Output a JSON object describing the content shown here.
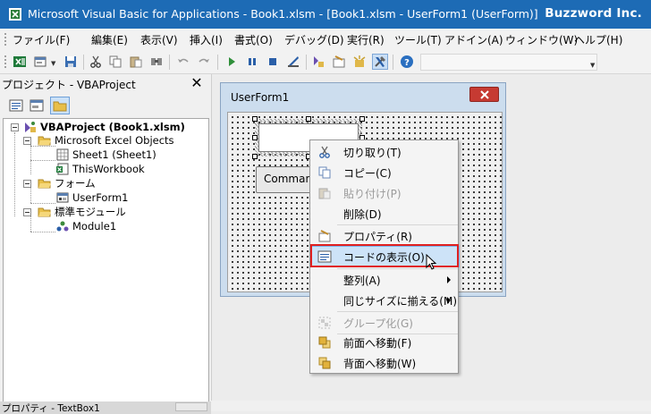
{
  "window": {
    "title": "Microsoft Visual Basic for Applications - Book1.xlsm - [Book1.xlsm - UserForm1 (UserForm)]",
    "brand": "Buzzword Inc."
  },
  "menu": [
    {
      "label": "ファイル(F)"
    },
    {
      "label": "編集(E)"
    },
    {
      "label": "表示(V)"
    },
    {
      "label": "挿入(I)"
    },
    {
      "label": "書式(O)"
    },
    {
      "label": "デバッグ(D)"
    },
    {
      "label": "実行(R)"
    },
    {
      "label": "ツール(T)"
    },
    {
      "label": "アドイン(A)"
    },
    {
      "label": "ウィンドウ(W)"
    },
    {
      "label": "ヘルプ(H)"
    }
  ],
  "toolbar": {
    "icons": [
      "excel-icon",
      "insert-userform-icon",
      "save-icon",
      "cut-icon",
      "copy-icon",
      "paste-icon",
      "find-icon",
      "undo-icon",
      "redo-icon",
      "run-icon",
      "break-icon",
      "reset-icon",
      "design-mode-icon",
      "project-explorer-icon",
      "properties-icon",
      "object-browser-icon",
      "toolbox-icon",
      "help-icon"
    ]
  },
  "project_panel": {
    "title": "プロジェクト - VBAProject",
    "tree": [
      {
        "label": "VBAProject (Book1.xlsm)"
      },
      {
        "label": "Microsoft Excel Objects"
      },
      {
        "label": "Sheet1 (Sheet1)"
      },
      {
        "label": "ThisWorkbook"
      },
      {
        "label": "フォーム"
      },
      {
        "label": "UserForm1"
      },
      {
        "label": "標準モジュール"
      },
      {
        "label": "Module1"
      }
    ],
    "properties_title": "プロパティ - TextBox1"
  },
  "userform": {
    "title": "UserForm1",
    "button_label": "CommandB"
  },
  "context_menu": {
    "items": [
      {
        "label": "切り取り(T)",
        "icon": "cut-icon",
        "enabled": true
      },
      {
        "label": "コピー(C)",
        "icon": "copy-icon",
        "enabled": true
      },
      {
        "label": "貼り付け(P)",
        "icon": "paste-icon",
        "enabled": false
      },
      {
        "label": "削除(D)",
        "icon": "",
        "enabled": true
      },
      {
        "label": "プロパティ(R)",
        "icon": "properties-icon",
        "enabled": true
      },
      {
        "label": "コードの表示(O)",
        "icon": "view-code-icon",
        "enabled": true,
        "highlighted": true
      },
      {
        "label": "整列(A)",
        "icon": "",
        "enabled": true,
        "submenu": true
      },
      {
        "label": "同じサイズに揃える(M)",
        "icon": "",
        "enabled": true,
        "submenu": true
      },
      {
        "label": "グループ化(G)",
        "icon": "group-icon",
        "enabled": false
      },
      {
        "label": "前面へ移動(F)",
        "icon": "bring-to-front-icon",
        "enabled": true
      },
      {
        "label": "背面へ移動(W)",
        "icon": "send-to-back-icon",
        "enabled": true
      }
    ]
  },
  "colors": {
    "titlebar": "#1d6bb5",
    "highlight": "#cde3f8",
    "annotation_box": "#e02020",
    "close_button": "#c63a32"
  }
}
